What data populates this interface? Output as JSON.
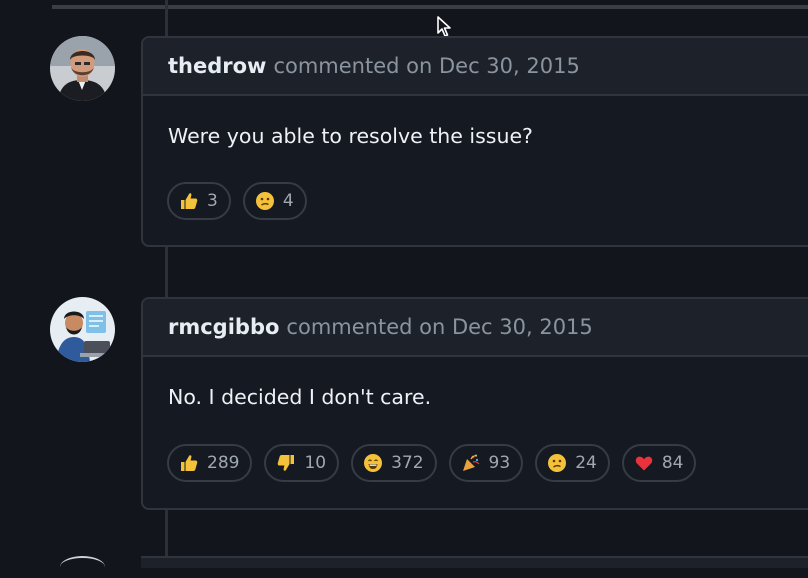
{
  "comments": [
    {
      "author": "thedrow",
      "meta": "commented on Dec 30, 2015",
      "body": "Were you able to resolve the issue?",
      "reactions": [
        {
          "icon": "thumbs-up-icon",
          "count": "3"
        },
        {
          "icon": "confused-face-icon",
          "count": "4"
        }
      ]
    },
    {
      "author": "rmcgibbo",
      "meta": "commented on Dec 30, 2015",
      "body": "No. I decided I don't care.",
      "reactions": [
        {
          "icon": "thumbs-up-icon",
          "count": "289"
        },
        {
          "icon": "thumbs-down-icon",
          "count": "10"
        },
        {
          "icon": "laugh-face-icon",
          "count": "372"
        },
        {
          "icon": "party-popper-icon",
          "count": "93"
        },
        {
          "icon": "confused-face-icon",
          "count": "24"
        },
        {
          "icon": "heart-icon",
          "count": "84"
        }
      ]
    }
  ],
  "colors": {
    "background": "#12151c",
    "header": "#1d222a",
    "border": "#30353d",
    "text": "#e6edf3",
    "muted": "#8b949e",
    "emoji_yellow": "#f4c23a",
    "heart_red": "#e8333d"
  }
}
